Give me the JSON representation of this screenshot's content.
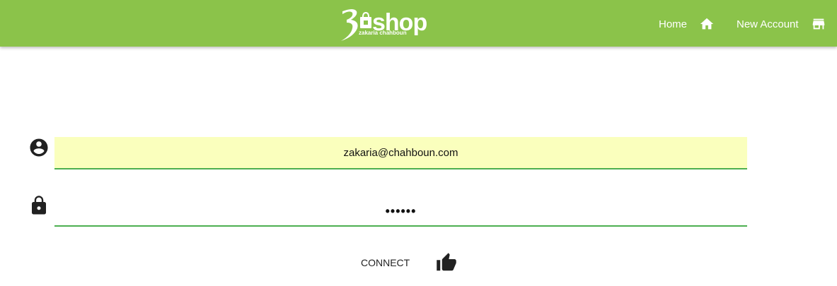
{
  "header": {
    "brand_word": "shop",
    "brand_sub": "zakaria chahboun",
    "nav": [
      {
        "label": "Home",
        "icon": "home-icon"
      },
      {
        "label": "New Account",
        "icon": "store-icon"
      }
    ]
  },
  "form": {
    "email": {
      "value": "zakaria@chahboun.com",
      "icon": "account-circle-icon"
    },
    "password": {
      "value": "••••••",
      "icon": "lock-icon"
    },
    "connect": {
      "label": "CONNECT",
      "icon": "thumb-up-icon"
    }
  },
  "colors": {
    "accent": "#8bc34a",
    "underline": "#4caf50",
    "autofill": "#faffbd"
  }
}
